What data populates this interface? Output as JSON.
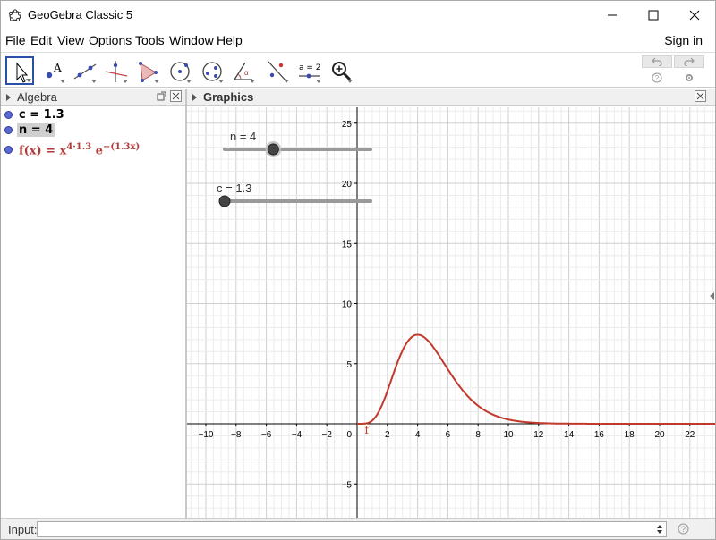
{
  "window": {
    "title": "GeoGebra Classic 5"
  },
  "menu": {
    "items": [
      {
        "label": "File"
      },
      {
        "label": "Edit"
      },
      {
        "label": "View"
      },
      {
        "label": "Options"
      },
      {
        "label": "Tools"
      },
      {
        "label": "Window"
      },
      {
        "label": "Help"
      }
    ],
    "sign_in": "Sign in"
  },
  "toolbar": {
    "tools": [
      {
        "icon": "move-arrow-icon"
      },
      {
        "icon": "point-icon"
      },
      {
        "icon": "line-icon"
      },
      {
        "icon": "perpendicular-line-icon"
      },
      {
        "icon": "polygon-icon"
      },
      {
        "icon": "circle-icon"
      },
      {
        "icon": "ellipse-icon"
      },
      {
        "icon": "angle-icon"
      },
      {
        "icon": "reflect-icon"
      },
      {
        "icon": "slider-icon",
        "label": "a = 2"
      },
      {
        "icon": "zoom-in-icon"
      }
    ]
  },
  "algebra": {
    "title": "Algebra",
    "items": [
      {
        "text": "c = 1.3"
      },
      {
        "text": "n = 4"
      },
      {
        "lhs": "f(x) = x",
        "exp1": "4·1.3",
        "mid": " e",
        "exp2": "−(1.3x)"
      }
    ]
  },
  "graphics": {
    "title": "Graphics",
    "function_label": "f",
    "sliders": [
      {
        "label": "n = 4",
        "value": 4,
        "min": 1,
        "max": 10
      },
      {
        "label": "c = 1.3",
        "value": 1.3,
        "min": 1.3,
        "max": 10
      }
    ],
    "x_ticks": [
      "−10",
      "−8",
      "−6",
      "−4",
      "−2",
      "0",
      "2",
      "4",
      "6",
      "8",
      "10",
      "12",
      "14",
      "16",
      "18",
      "20",
      "22"
    ],
    "y_ticks": [
      "−5",
      "5",
      "10",
      "15",
      "20",
      "25"
    ],
    "colors": {
      "function": "#c0392b",
      "axis": "#000000",
      "grid": "#e0e0e0",
      "slider_point": "#444444"
    }
  },
  "input": {
    "label": "Input:",
    "value": "",
    "placeholder": ""
  }
}
